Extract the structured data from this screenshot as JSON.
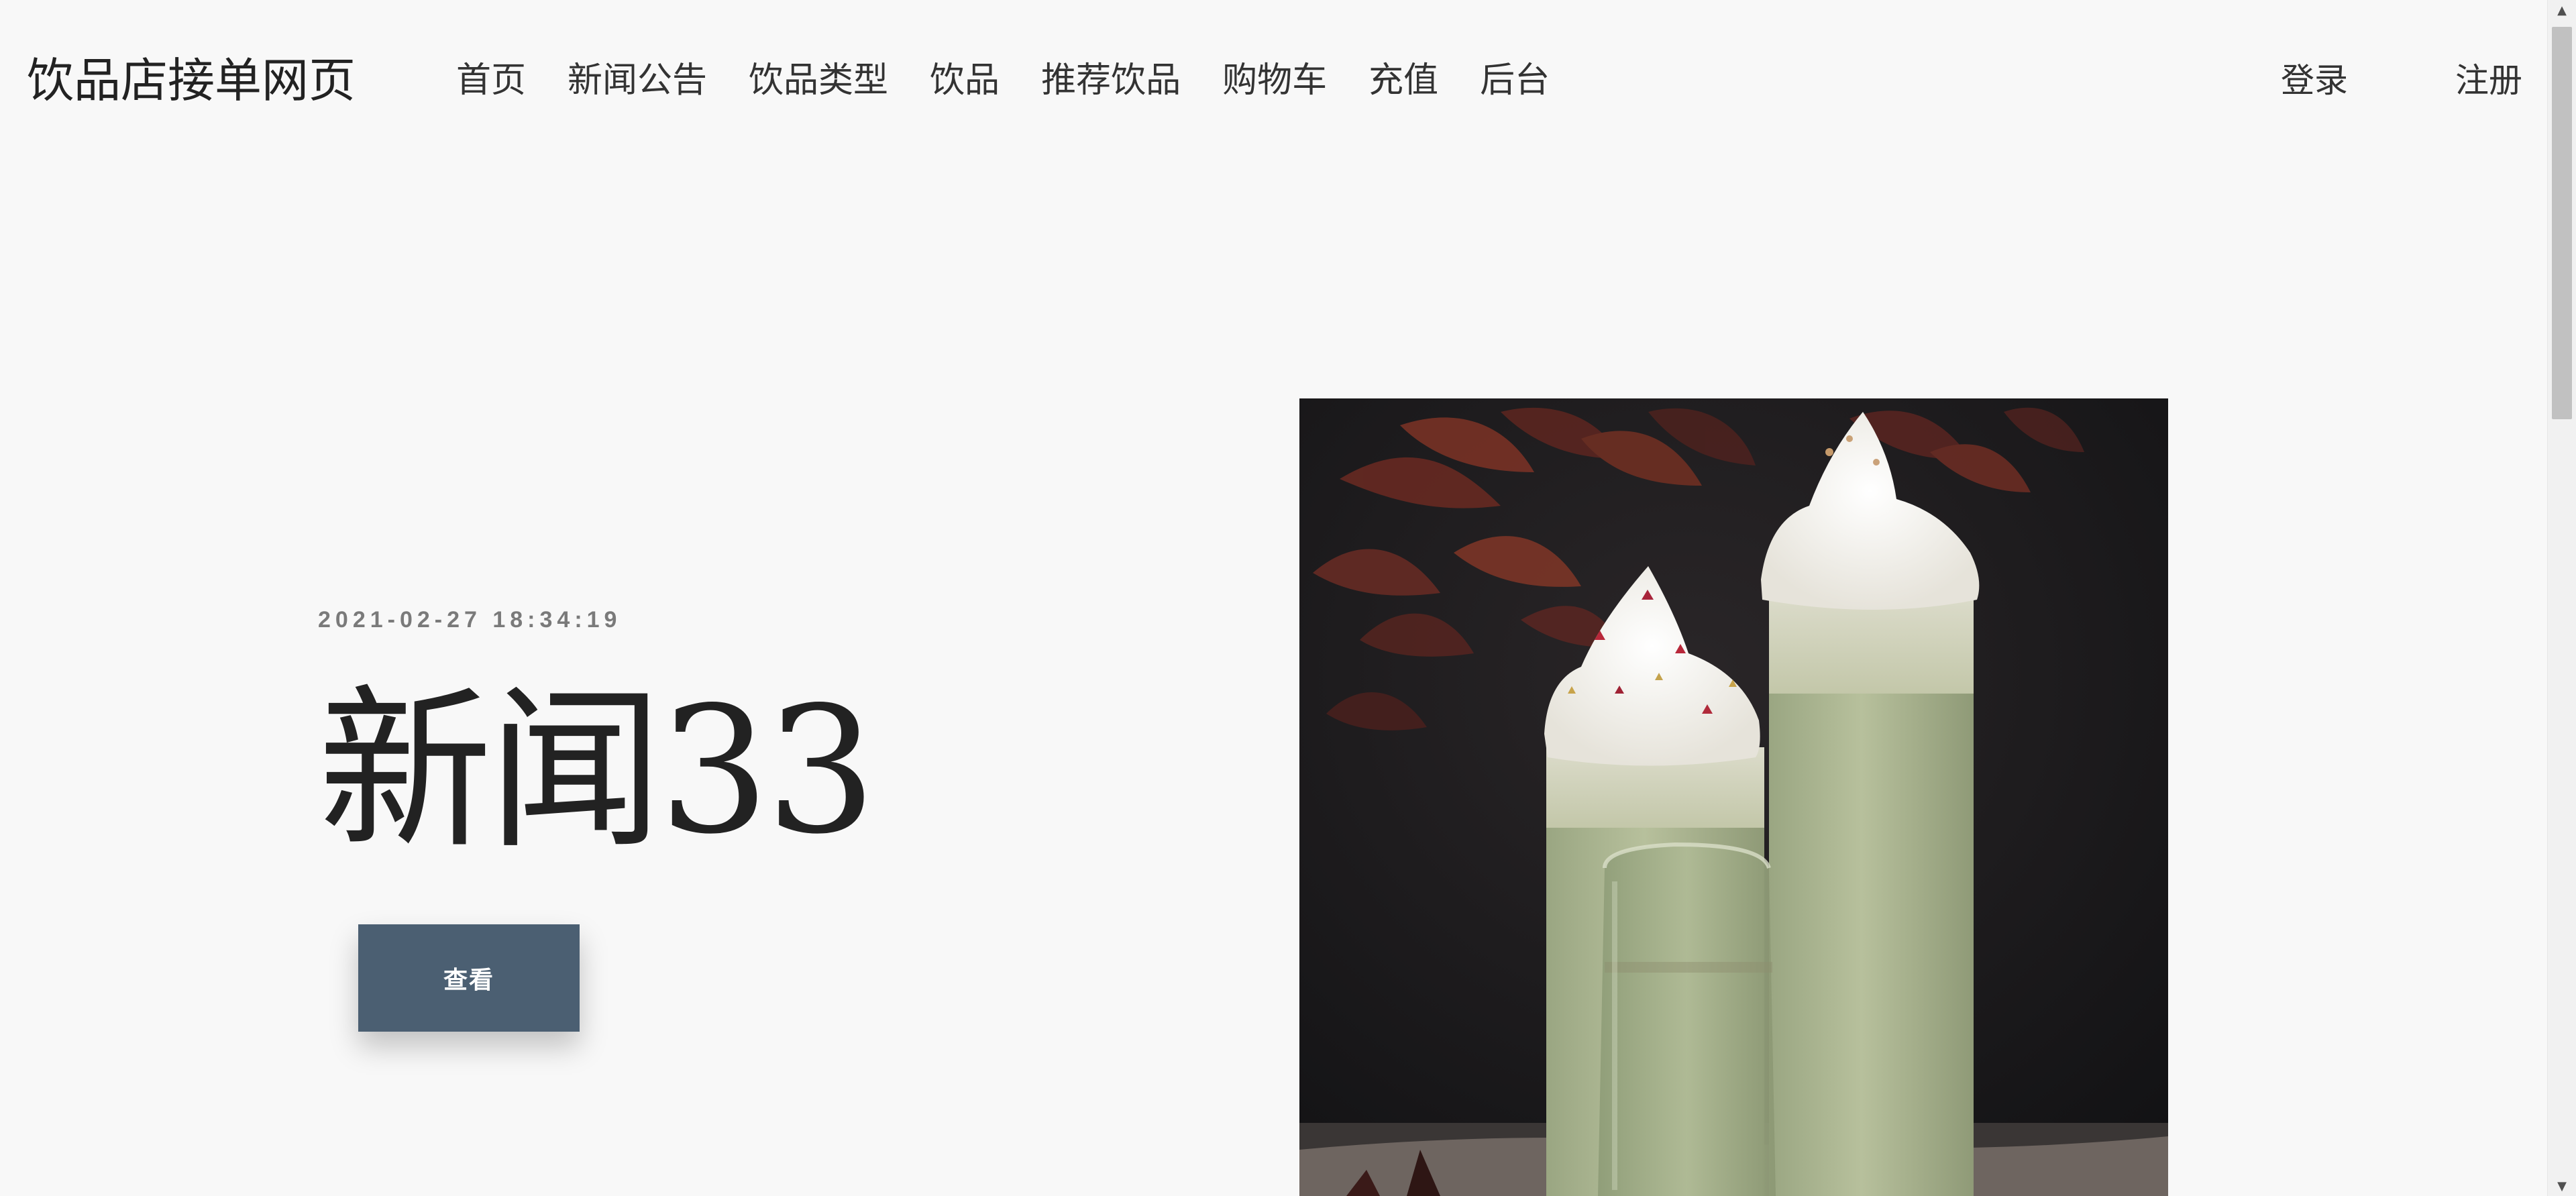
{
  "header": {
    "brand": "饮品店接单网页",
    "nav": [
      "首页",
      "新闻公告",
      "饮品类型",
      "饮品",
      "推荐饮品",
      "购物车",
      "充值",
      "后台"
    ],
    "login": "登录",
    "register": "注册"
  },
  "hero": {
    "date": "2021-02-27 18:34:19",
    "title": "新闻33",
    "button": "查看",
    "image_subject": "matcha-frappe-drinks"
  },
  "colors": {
    "background": "#f8f8f8",
    "button": "#4b5f72",
    "button_text": "#ffffff",
    "date_text": "#7a7a7a"
  }
}
